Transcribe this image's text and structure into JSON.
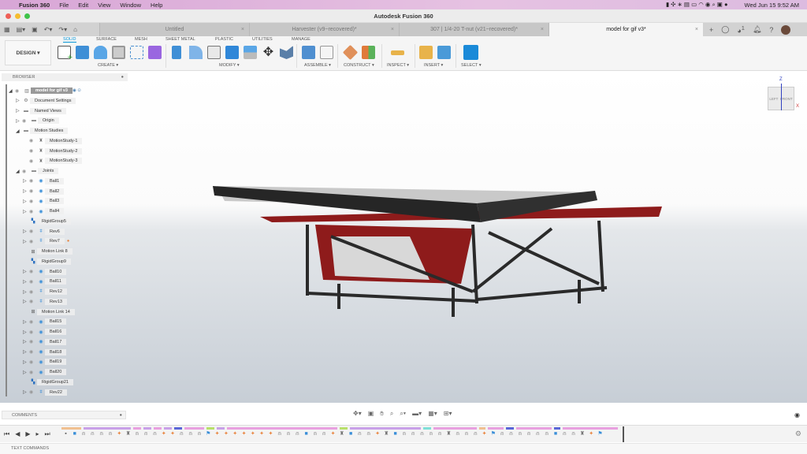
{
  "menubar": {
    "app": "Fusion 360",
    "items": [
      "File",
      "Edit",
      "View",
      "Window",
      "Help"
    ],
    "clock": "Wed Jun 15  9:52 AM"
  },
  "window": {
    "title": "Autodesk Fusion 360"
  },
  "tabs": [
    {
      "label": "Untitled",
      "active": false
    },
    {
      "label": "Harvester (v9~recovered)*",
      "active": false
    },
    {
      "label": "307 | 1/4-20 T-nut (v21~recovered)*",
      "active": false
    },
    {
      "label": "model for gif v3*",
      "active": true
    }
  ],
  "header": {
    "notifications": "1"
  },
  "ribbon": {
    "workspace": "DESIGN ▾",
    "tabs": [
      "SOLID",
      "SURFACE",
      "MESH",
      "SHEET METAL",
      "PLASTIC",
      "UTILITIES",
      "MANAGE"
    ],
    "groups": [
      "CREATE ▾",
      "MODIFY ▾",
      "ASSEMBLE ▾",
      "CONSTRUCT ▾",
      "INSPECT ▾",
      "INSERT ▾",
      "SELECT ▾"
    ]
  },
  "browser": {
    "title": "BROWSER",
    "items": [
      {
        "label": "model for gif v3",
        "level": 0,
        "exp": "open",
        "icon": "component"
      },
      {
        "label": "Document Settings",
        "level": 1,
        "exp": "closed",
        "icon": "gear"
      },
      {
        "label": "Named Views",
        "level": 1,
        "exp": "closed",
        "icon": "folder"
      },
      {
        "label": "Origin",
        "level": 1,
        "exp": "closed",
        "icon": "folder",
        "eye": true
      },
      {
        "label": "Motion Studies",
        "level": 1,
        "exp": "open",
        "icon": "folder"
      },
      {
        "label": "MotionStudy-1",
        "level": 2,
        "exp": "",
        "icon": "motion",
        "eye": true
      },
      {
        "label": "MotionStudy-2",
        "level": 2,
        "exp": "",
        "icon": "motion",
        "eye": true
      },
      {
        "label": "MotionStudy-3",
        "level": 2,
        "exp": "",
        "icon": "motion",
        "eye": true
      },
      {
        "label": "Joints",
        "level": 1,
        "exp": "open",
        "icon": "folder",
        "eye": true
      },
      {
        "label": "Ball1",
        "level": 2,
        "exp": "closed",
        "icon": "ball",
        "eye": true
      },
      {
        "label": "Ball2",
        "level": 2,
        "exp": "closed",
        "icon": "ball",
        "eye": true
      },
      {
        "label": "Ball3",
        "level": 2,
        "exp": "closed",
        "icon": "ball",
        "eye": true
      },
      {
        "label": "Ball4",
        "level": 2,
        "exp": "closed",
        "icon": "ball",
        "eye": true
      },
      {
        "label": "RigidGroup5",
        "level": 2,
        "exp": "",
        "icon": "rigid"
      },
      {
        "label": "Rev6",
        "level": 2,
        "exp": "closed",
        "icon": "rev",
        "eye": true
      },
      {
        "label": "Rev7",
        "level": 2,
        "exp": "closed",
        "icon": "rev",
        "eye": true,
        "warn": true
      },
      {
        "label": "Motion Link 8",
        "level": 2,
        "exp": "",
        "icon": "link"
      },
      {
        "label": "RigidGroup9",
        "level": 2,
        "exp": "",
        "icon": "rigid"
      },
      {
        "label": "Ball10",
        "level": 2,
        "exp": "closed",
        "icon": "ball",
        "eye": true
      },
      {
        "label": "Ball11",
        "level": 2,
        "exp": "closed",
        "icon": "ball",
        "eye": true
      },
      {
        "label": "Rev12",
        "level": 2,
        "exp": "closed",
        "icon": "rev",
        "eye": true
      },
      {
        "label": "Rev13",
        "level": 2,
        "exp": "closed",
        "icon": "rev",
        "eye": true
      },
      {
        "label": "Motion Link 14",
        "level": 2,
        "exp": "",
        "icon": "link"
      },
      {
        "label": "Ball15",
        "level": 2,
        "exp": "closed",
        "icon": "ball",
        "eye": true
      },
      {
        "label": "Ball16",
        "level": 2,
        "exp": "closed",
        "icon": "ball",
        "eye": true
      },
      {
        "label": "Ball17",
        "level": 2,
        "exp": "closed",
        "icon": "ball",
        "eye": true
      },
      {
        "label": "Ball18",
        "level": 2,
        "exp": "closed",
        "icon": "ball",
        "eye": true
      },
      {
        "label": "Ball19",
        "level": 2,
        "exp": "closed",
        "icon": "ball",
        "eye": true
      },
      {
        "label": "Ball20",
        "level": 2,
        "exp": "closed",
        "icon": "ball",
        "eye": true
      },
      {
        "label": "RigidGroup21",
        "level": 2,
        "exp": "",
        "icon": "rigid"
      },
      {
        "label": "Rev22",
        "level": 2,
        "exp": "closed",
        "icon": "rev",
        "eye": true
      }
    ]
  },
  "viewcube": {
    "left": "LEFT",
    "front": "FRONT",
    "z": "Z",
    "x": "X"
  },
  "comments": {
    "label": "COMMENTS"
  },
  "text_commands": {
    "label": "TEXT COMMANDS"
  },
  "timeline": {
    "items": "gbjjjjpmjjjppjjjfpppppppjjjbjjpmbjjpmbjjjjjmjjjpfjjjjjjbjjmpf"
  },
  "colors": {
    "accent": "#0696d7",
    "frame": "#2b2b2b",
    "panel": "#8e1b1b"
  }
}
